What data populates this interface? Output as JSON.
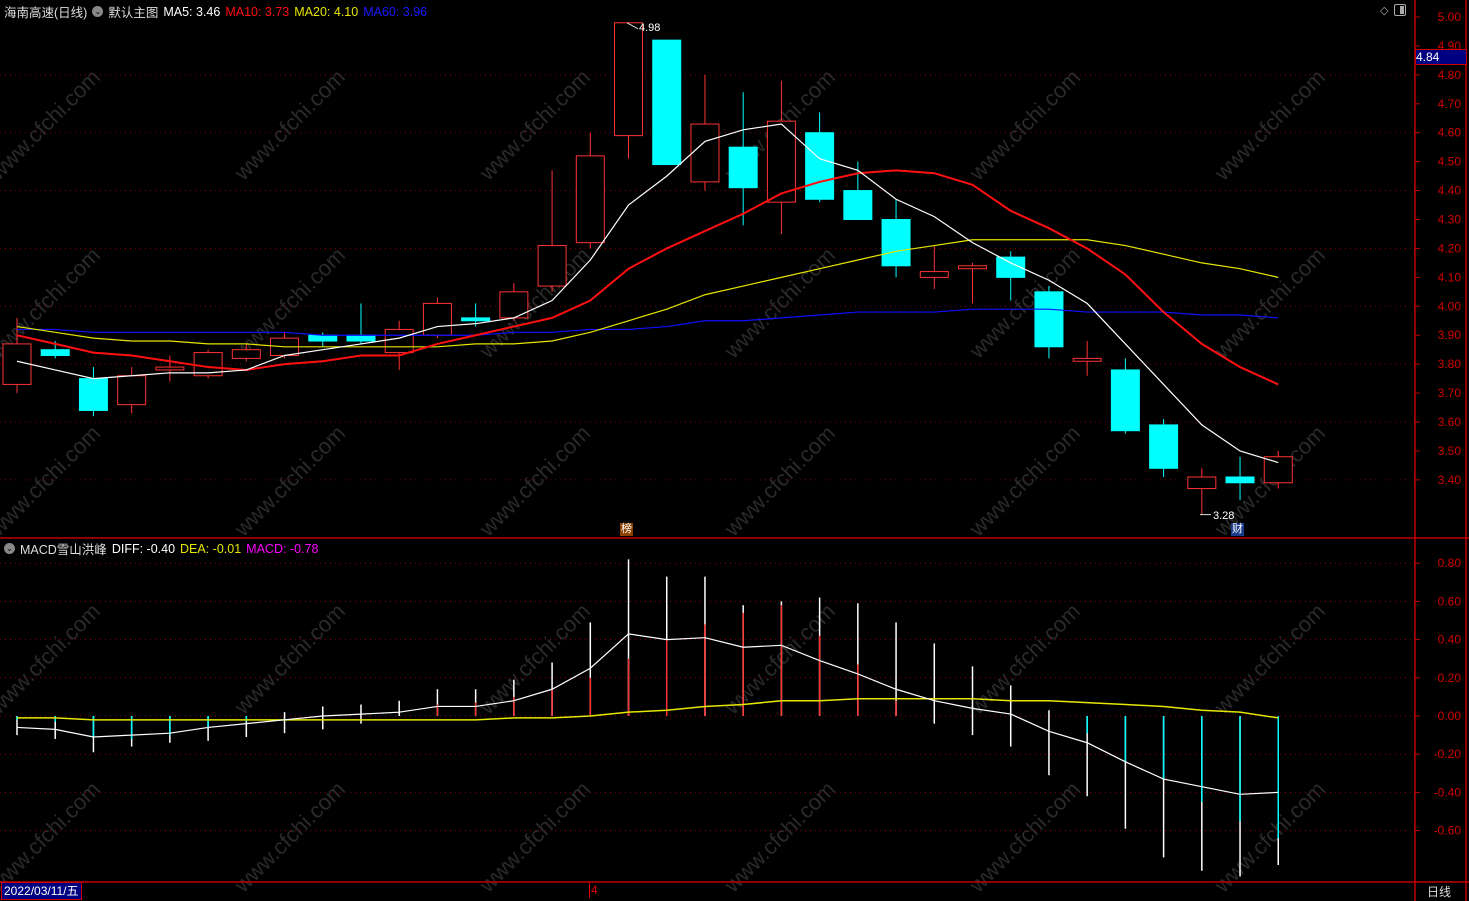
{
  "header": {
    "stock_name": "海南高速(日线)",
    "main_indicator": "默认主图",
    "ma5_label": "MA5: 3.46",
    "ma10_label": "MA10: 3.73",
    "ma20_label": "MA20: 4.10",
    "ma60_label": "MA60: 3.96"
  },
  "macd_header": {
    "name": "MACD雪山洪峰",
    "diff_label": "DIFF: -0.40",
    "dea_label": "DEA: -0.01",
    "macd_label": "MACD: -0.78"
  },
  "footer": {
    "date": "2022/03/11/五",
    "month_marker": "4",
    "period": "日线"
  },
  "crosshair_price": "4.84",
  "markers": {
    "high": "4.98",
    "low": "3.28",
    "list_badge": "榜",
    "finance_badge": "财"
  },
  "watermark": "www.cfchi.com",
  "colors": {
    "up": "#ff3232",
    "down": "#00ffff",
    "ma5": "#ffffff",
    "ma10": "#ff1010",
    "ma20": "#e6e600",
    "ma60": "#1010ff",
    "axis": "#c00000"
  },
  "chart_data": {
    "type": "candlestick",
    "price_axis": {
      "ylim": [
        3.25,
        5.0
      ],
      "ticks": [
        "5.00",
        "4.90",
        "4.80",
        "4.70",
        "4.60",
        "4.50",
        "4.40",
        "4.30",
        "4.20",
        "4.10",
        "4.00",
        "3.90",
        "3.80",
        "3.70",
        "3.60",
        "3.50",
        "3.40"
      ]
    },
    "candles": [
      [
        3.73,
        3.96,
        3.7,
        3.87
      ],
      [
        3.85,
        3.88,
        3.82,
        3.83
      ],
      [
        3.75,
        3.79,
        3.62,
        3.64
      ],
      [
        3.66,
        3.79,
        3.63,
        3.76
      ],
      [
        3.78,
        3.83,
        3.74,
        3.79
      ],
      [
        3.76,
        3.85,
        3.75,
        3.84
      ],
      [
        3.82,
        3.87,
        3.81,
        3.85
      ],
      [
        3.83,
        3.91,
        3.82,
        3.89
      ],
      [
        3.9,
        3.91,
        3.86,
        3.88
      ],
      [
        3.9,
        4.01,
        3.87,
        3.88
      ],
      [
        3.84,
        3.95,
        3.78,
        3.92
      ],
      [
        3.9,
        4.03,
        3.89,
        4.01
      ],
      [
        3.96,
        4.01,
        3.93,
        3.95
      ],
      [
        3.96,
        4.08,
        3.95,
        4.05
      ],
      [
        4.07,
        4.47,
        4.05,
        4.21
      ],
      [
        4.22,
        4.6,
        4.2,
        4.52
      ],
      [
        4.59,
        4.98,
        4.51,
        4.98
      ],
      [
        4.92,
        4.92,
        4.49,
        4.49
      ],
      [
        4.43,
        4.8,
        4.4,
        4.63
      ],
      [
        4.55,
        4.74,
        4.28,
        4.41
      ],
      [
        4.36,
        4.78,
        4.25,
        4.64
      ],
      [
        4.6,
        4.67,
        4.36,
        4.37
      ],
      [
        4.4,
        4.5,
        4.3,
        4.3
      ],
      [
        4.3,
        4.37,
        4.1,
        4.14
      ],
      [
        4.1,
        4.21,
        4.06,
        4.12
      ],
      [
        4.13,
        4.15,
        4.01,
        4.14
      ],
      [
        4.17,
        4.19,
        4.02,
        4.1
      ],
      [
        4.05,
        4.07,
        3.82,
        3.86
      ],
      [
        3.81,
        3.88,
        3.76,
        3.82
      ],
      [
        3.78,
        3.82,
        3.56,
        3.57
      ],
      [
        3.59,
        3.61,
        3.41,
        3.44
      ],
      [
        3.37,
        3.44,
        3.28,
        3.41
      ],
      [
        3.41,
        3.48,
        3.33,
        3.39
      ],
      [
        3.39,
        3.5,
        3.37,
        3.48
      ]
    ],
    "candle_fields": [
      "open",
      "high",
      "low",
      "close"
    ],
    "ma5": [
      3.81,
      3.78,
      3.75,
      3.76,
      3.77,
      3.77,
      3.78,
      3.83,
      3.85,
      3.87,
      3.89,
      3.93,
      3.94,
      3.96,
      4.02,
      4.16,
      4.35,
      4.45,
      4.57,
      4.61,
      4.63,
      4.51,
      4.47,
      4.37,
      4.31,
      4.22,
      4.15,
      4.09,
      4.01,
      3.87,
      3.73,
      3.59,
      3.5,
      3.46
    ],
    "ma10": [
      3.9,
      3.87,
      3.84,
      3.83,
      3.81,
      3.79,
      3.78,
      3.8,
      3.81,
      3.83,
      3.83,
      3.87,
      3.9,
      3.93,
      3.96,
      4.02,
      4.13,
      4.2,
      4.26,
      4.32,
      4.39,
      4.43,
      4.46,
      4.47,
      4.46,
      4.42,
      4.33,
      4.27,
      4.2,
      4.11,
      3.98,
      3.87,
      3.79,
      3.73
    ],
    "ma20": [
      3.93,
      3.91,
      3.89,
      3.88,
      3.88,
      3.87,
      3.87,
      3.86,
      3.86,
      3.86,
      3.86,
      3.86,
      3.87,
      3.87,
      3.88,
      3.91,
      3.95,
      3.99,
      4.04,
      4.07,
      4.1,
      4.13,
      4.16,
      4.19,
      4.21,
      4.23,
      4.23,
      4.23,
      4.23,
      4.21,
      4.18,
      4.15,
      4.13,
      4.1
    ],
    "ma60": [
      3.92,
      3.92,
      3.91,
      3.91,
      3.91,
      3.91,
      3.91,
      3.91,
      3.9,
      3.9,
      3.9,
      3.9,
      3.9,
      3.91,
      3.91,
      3.92,
      3.92,
      3.93,
      3.95,
      3.95,
      3.96,
      3.97,
      3.98,
      3.98,
      3.98,
      3.99,
      3.99,
      3.99,
      3.98,
      3.98,
      3.98,
      3.97,
      3.97,
      3.96
    ],
    "macd_axis": {
      "ylim": [
        -0.9,
        0.9
      ],
      "ticks": [
        "0.80",
        "0.60",
        "0.40",
        "0.20",
        "0.00",
        "-0.20",
        "-0.40",
        "-0.60"
      ]
    },
    "macd_bars_range": [
      [
        -0.1,
        0
      ],
      [
        -0.12,
        0
      ],
      [
        -0.19,
        0
      ],
      [
        -0.16,
        0
      ],
      [
        -0.14,
        0
      ],
      [
        -0.13,
        0
      ],
      [
        -0.11,
        0
      ],
      [
        -0.09,
        0.02
      ],
      [
        -0.07,
        0.05
      ],
      [
        -0.04,
        0.06
      ],
      [
        0,
        0.08
      ],
      [
        0,
        0.14
      ],
      [
        0,
        0.14
      ],
      [
        0,
        0.19
      ],
      [
        0,
        0.28
      ],
      [
        0,
        0.49
      ],
      [
        0,
        0.82
      ],
      [
        0,
        0.73
      ],
      [
        0,
        0.73
      ],
      [
        0,
        0.58
      ],
      [
        0,
        0.6
      ],
      [
        0,
        0.62
      ],
      [
        0,
        0.59
      ],
      [
        0,
        0.49
      ],
      [
        -0.04,
        0.38
      ],
      [
        -0.1,
        0.26
      ],
      [
        -0.16,
        0.16
      ],
      [
        -0.31,
        0.03
      ],
      [
        -0.42,
        0
      ],
      [
        -0.59,
        0
      ],
      [
        -0.74,
        0
      ],
      [
        -0.81,
        0
      ],
      [
        -0.84,
        0
      ],
      [
        -0.78,
        0
      ]
    ],
    "macd_fill": [
      -0.02,
      -0.03,
      -0.11,
      -0.12,
      -0.1,
      -0.06,
      -0.03,
      0,
      0,
      0,
      0,
      0.06,
      0.07,
      0.1,
      0.14,
      0.2,
      0.3,
      0.4,
      0.48,
      0.54,
      0.58,
      0.42,
      0.27,
      0.08,
      0,
      0,
      0,
      0,
      -0.09,
      -0.24,
      -0.33,
      -0.45,
      -0.55,
      -0.64
    ],
    "diff": [
      -0.06,
      -0.07,
      -0.11,
      -0.1,
      -0.09,
      -0.06,
      -0.04,
      -0.02,
      0,
      0.01,
      0.02,
      0.05,
      0.05,
      0.08,
      0.14,
      0.25,
      0.43,
      0.4,
      0.41,
      0.36,
      0.37,
      0.29,
      0.22,
      0.14,
      0.08,
      0.04,
      0.01,
      -0.08,
      -0.14,
      -0.24,
      -0.33,
      -0.37,
      -0.41,
      -0.4
    ],
    "dea": [
      -0.01,
      -0.01,
      -0.02,
      -0.02,
      -0.02,
      -0.02,
      -0.02,
      -0.02,
      -0.02,
      -0.02,
      -0.02,
      -0.02,
      -0.02,
      -0.01,
      -0.01,
      0,
      0.02,
      0.03,
      0.05,
      0.06,
      0.08,
      0.08,
      0.09,
      0.09,
      0.09,
      0.09,
      0.08,
      0.08,
      0.07,
      0.06,
      0.05,
      0.03,
      0.02,
      -0.01
    ]
  }
}
